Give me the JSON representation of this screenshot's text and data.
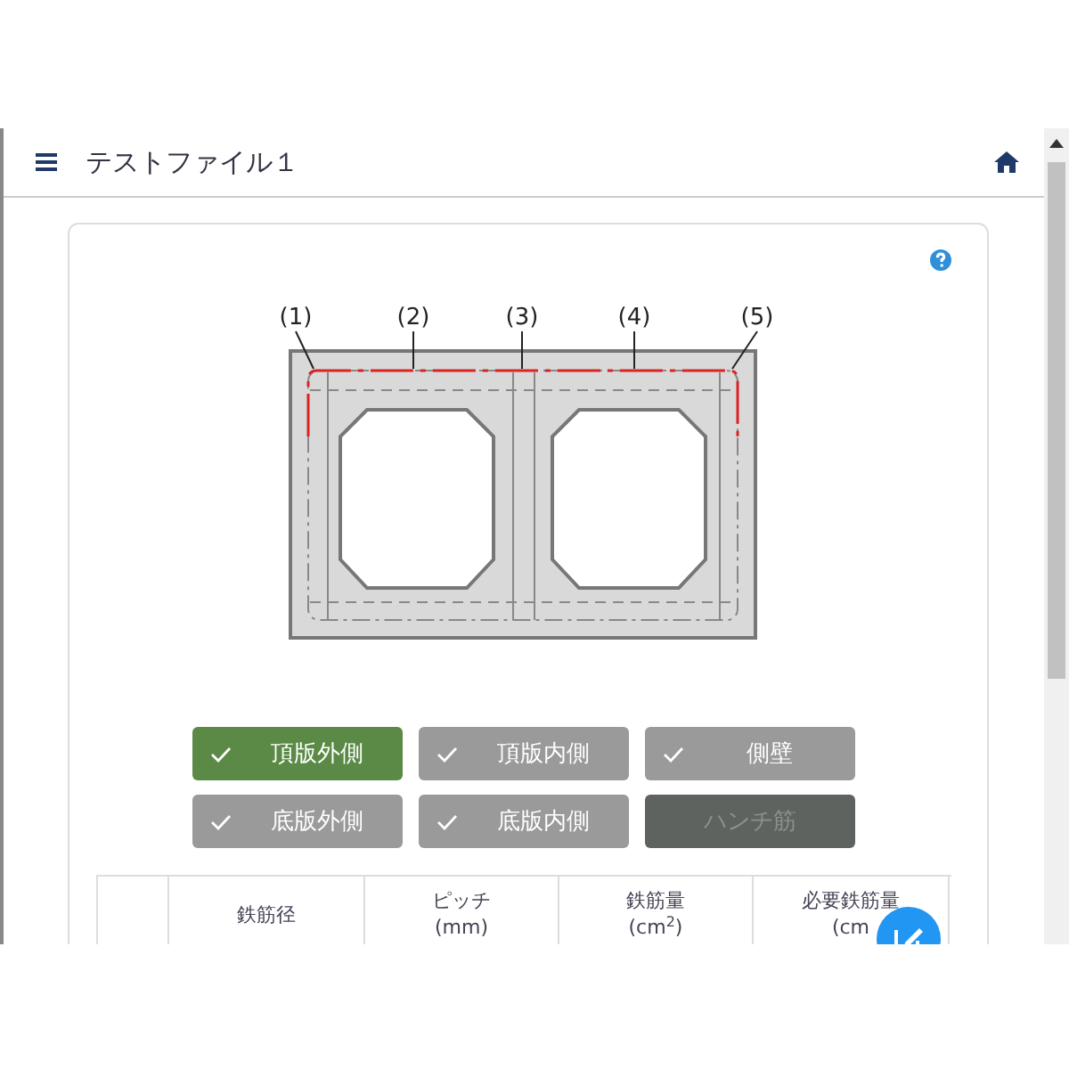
{
  "header": {
    "title": "テストファイル１"
  },
  "diagram": {
    "labels": [
      "(1)",
      "(2)",
      "(3)",
      "(4)",
      "(5)"
    ]
  },
  "toggles": [
    {
      "label": "頂版外側",
      "selected": true,
      "disabled": false
    },
    {
      "label": "頂版内側",
      "selected": false,
      "disabled": false
    },
    {
      "label": "側壁",
      "selected": false,
      "disabled": false
    },
    {
      "label": "底版外側",
      "selected": false,
      "disabled": false
    },
    {
      "label": "底版内側",
      "selected": false,
      "disabled": false
    },
    {
      "label": "ハンチ筋",
      "selected": false,
      "disabled": true
    }
  ],
  "table": {
    "columns": [
      "",
      "鉄筋径",
      "ピッチ\n(mm)",
      "鉄筋量\n(cm$^{2}$)",
      "必要鉄筋量\n(cm"
    ]
  }
}
